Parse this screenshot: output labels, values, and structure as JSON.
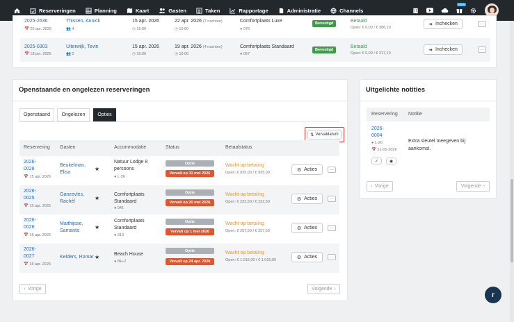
{
  "nav": {
    "items": [
      {
        "label": "Reserveringen",
        "icon": "calendar-check-icon"
      },
      {
        "label": "Planning",
        "icon": "grid-icon"
      },
      {
        "label": "Kaart",
        "icon": "map-icon"
      },
      {
        "label": "Gasten",
        "icon": "users-icon"
      },
      {
        "label": "Taken",
        "icon": "list-icon"
      },
      {
        "label": "Rapportage",
        "icon": "chart-icon"
      },
      {
        "label": "Administratie",
        "icon": "document-icon"
      },
      {
        "label": "Channels",
        "icon": "globe-icon"
      }
    ],
    "new_badge": "NEW"
  },
  "top_rows": [
    {
      "code": "2025-2636",
      "created": "25 apr. 2025",
      "guest": "Thissen, Annick",
      "persons": "4",
      "arrival": "15 apr. 2026",
      "arrival_time": "15:00",
      "departure": "22 apr. 2026",
      "nights": "(7 nachten)",
      "departure_time": "10:00",
      "accommodation": "Comfortplaats Luxe",
      "pitch": "076",
      "status": "Bevestigd",
      "pay_status": "Betaald",
      "pay_amount": "Open: € 0,00 / € 386,10",
      "action": "Inchecken"
    },
    {
      "code": "2025-0303",
      "created": "18 jan. 2025",
      "guest": "Uiterwijk, Tevin",
      "persons": "2",
      "arrival": "15 apr. 2026",
      "arrival_time": "15:00",
      "departure": "19 apr. 2026",
      "nights": "(4 nachten)",
      "departure_time": "10:00",
      "accommodation": "Comfortplaats Standaard",
      "pitch": "057",
      "status": "Bevestigd",
      "pay_status": "Betaald",
      "pay_amount": "Open: € 0,00 / € 217,10",
      "action": "Inchecken"
    }
  ],
  "open": {
    "title": "Openstaande en ongelezen reserveringen",
    "tabs": [
      "Openstaand",
      "Ongelezen",
      "Opties"
    ],
    "sort_label": "Vervaldatum",
    "headers": [
      "Reservering",
      "Gasten",
      "Accommodatie",
      "Status",
      "Betaalstatus"
    ],
    "rows": [
      {
        "code_a": "2026-",
        "code_b": "0028",
        "created": "15 apr. 2026",
        "guest_a": "Beukelman,",
        "guest_b": "Elisa",
        "acc_a": "Natuur Lodge 8",
        "acc_b": "persoons",
        "pitch": "L-26",
        "status": "Optie",
        "expiry": "Vervalt op 31 mei 2026",
        "pay_status": "Wacht op betaling",
        "pay_amount": "Open: € 935,00 / € 935,00",
        "action": "Acties"
      },
      {
        "code_a": "2026-",
        "code_b": "0025",
        "created": "15 apr. 2026",
        "guest_a": "Ganzevles,",
        "guest_b": "Rachél",
        "acc_a": "Comfortplaats",
        "acc_b": "Standaard",
        "pitch": "041",
        "status": "Optie",
        "expiry": "Vervalt op 20 mei 2026",
        "pay_status": "Wacht op betaling",
        "pay_amount": "Open: € 232,50 / € 232,50",
        "action": "Acties"
      },
      {
        "code_a": "2026-",
        "code_b": "0026",
        "created": "15 apr. 2026",
        "guest_a": "Matthijsse,",
        "guest_b": "Samanta",
        "acc_a": "Comfortplaats",
        "acc_b": "Standaard",
        "pitch": "013",
        "status": "Optie",
        "expiry": "Vervalt op 1 mei 2026",
        "pay_status": "Wacht op betaling",
        "pay_amount": "Open: € 257,50 / € 257,50",
        "action": "Acties"
      },
      {
        "code_a": "2026-",
        "code_b": "0027",
        "created": "15 apr. 2026",
        "guest_a": "Kelders, Romar",
        "guest_b": "",
        "acc_a": "Beach House",
        "acc_b": "",
        "pitch": "BH-2",
        "status": "Optie",
        "expiry": "Vervalt op 24 apr. 2026",
        "pay_status": "Wacht op betaling",
        "pay_amount": "Open: € 1.015,00 / € 1.015,00",
        "action": "Acties"
      }
    ],
    "prev": "Vorige",
    "next": "Volgende"
  },
  "notes": {
    "title": "Uitgelichte notities",
    "headers": [
      "Reservering",
      "Notitie"
    ],
    "row": {
      "code_a": "2026-",
      "code_b": "0004",
      "pitch": "L-20",
      "date": "21-01-2026",
      "note_a": "Extra sleutel meegeven bij",
      "note_b": "aankomst."
    },
    "prev": "Vorige",
    "next": "Volgende"
  },
  "fab_label": "r",
  "colors": {
    "nav_bg": "#23282d",
    "link": "#2b6cb0",
    "confirmed": "#3b9d4a",
    "expiry": "#e2562d",
    "waiting": "#e8952b",
    "highlight": "#d9413a"
  }
}
